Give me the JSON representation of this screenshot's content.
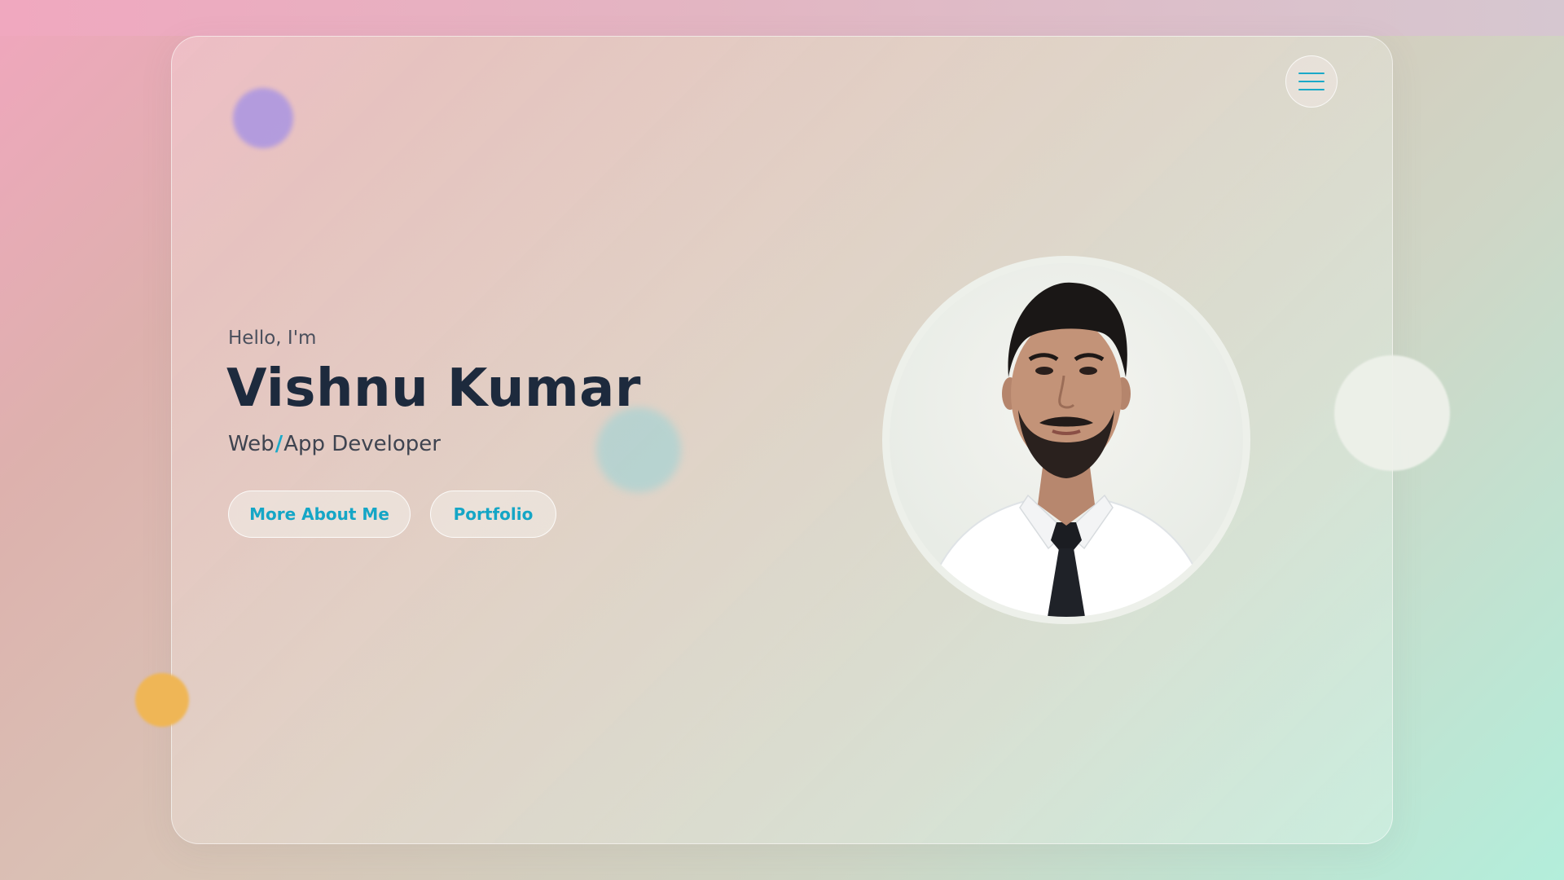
{
  "hero": {
    "greeting": "Hello, I'm",
    "name": "Vishnu Kumar",
    "role_part1": "Web",
    "role_separator": "/",
    "role_part2": "App Developer"
  },
  "buttons": {
    "about_label": "More About Me",
    "portfolio_label": "Portfolio"
  },
  "menu": {
    "icon": "hamburger-menu-icon"
  },
  "colors": {
    "accent": "#1aa9c8",
    "heading": "#1d2a3d",
    "blob_purple": "#b19adf",
    "blob_teal": "#a7d3d4",
    "blob_orange": "#efb656"
  }
}
